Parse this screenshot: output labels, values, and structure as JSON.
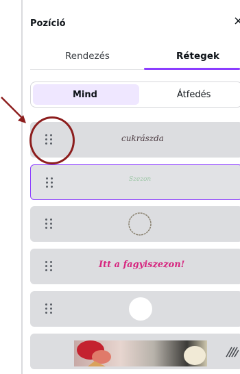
{
  "panel": {
    "title": "Pozíció",
    "close_symbol": "×"
  },
  "tabs": [
    {
      "label": "Rendezés",
      "active": false
    },
    {
      "label": "Rétegek",
      "active": true
    }
  ],
  "filter": {
    "options": [
      "Mind",
      "Átfedés"
    ],
    "selected": "Mind"
  },
  "layers": [
    {
      "kind": "text",
      "preview": "cukrászda",
      "selected": false
    },
    {
      "kind": "text",
      "preview": "Szezon",
      "selected": true
    },
    {
      "kind": "shape",
      "preview": "ring-outline",
      "selected": false
    },
    {
      "kind": "text",
      "preview": "Itt a fagyiszezon!",
      "selected": false
    },
    {
      "kind": "shape",
      "preview": "white-circle",
      "selected": false
    },
    {
      "kind": "image",
      "preview": "ice-cream-photo",
      "selected": false
    }
  ],
  "colors": {
    "accent": "#8b3dff",
    "layer_bg": "#dcdde0",
    "annotation": "#8c1d1d",
    "pink_text": "#d6267f"
  }
}
